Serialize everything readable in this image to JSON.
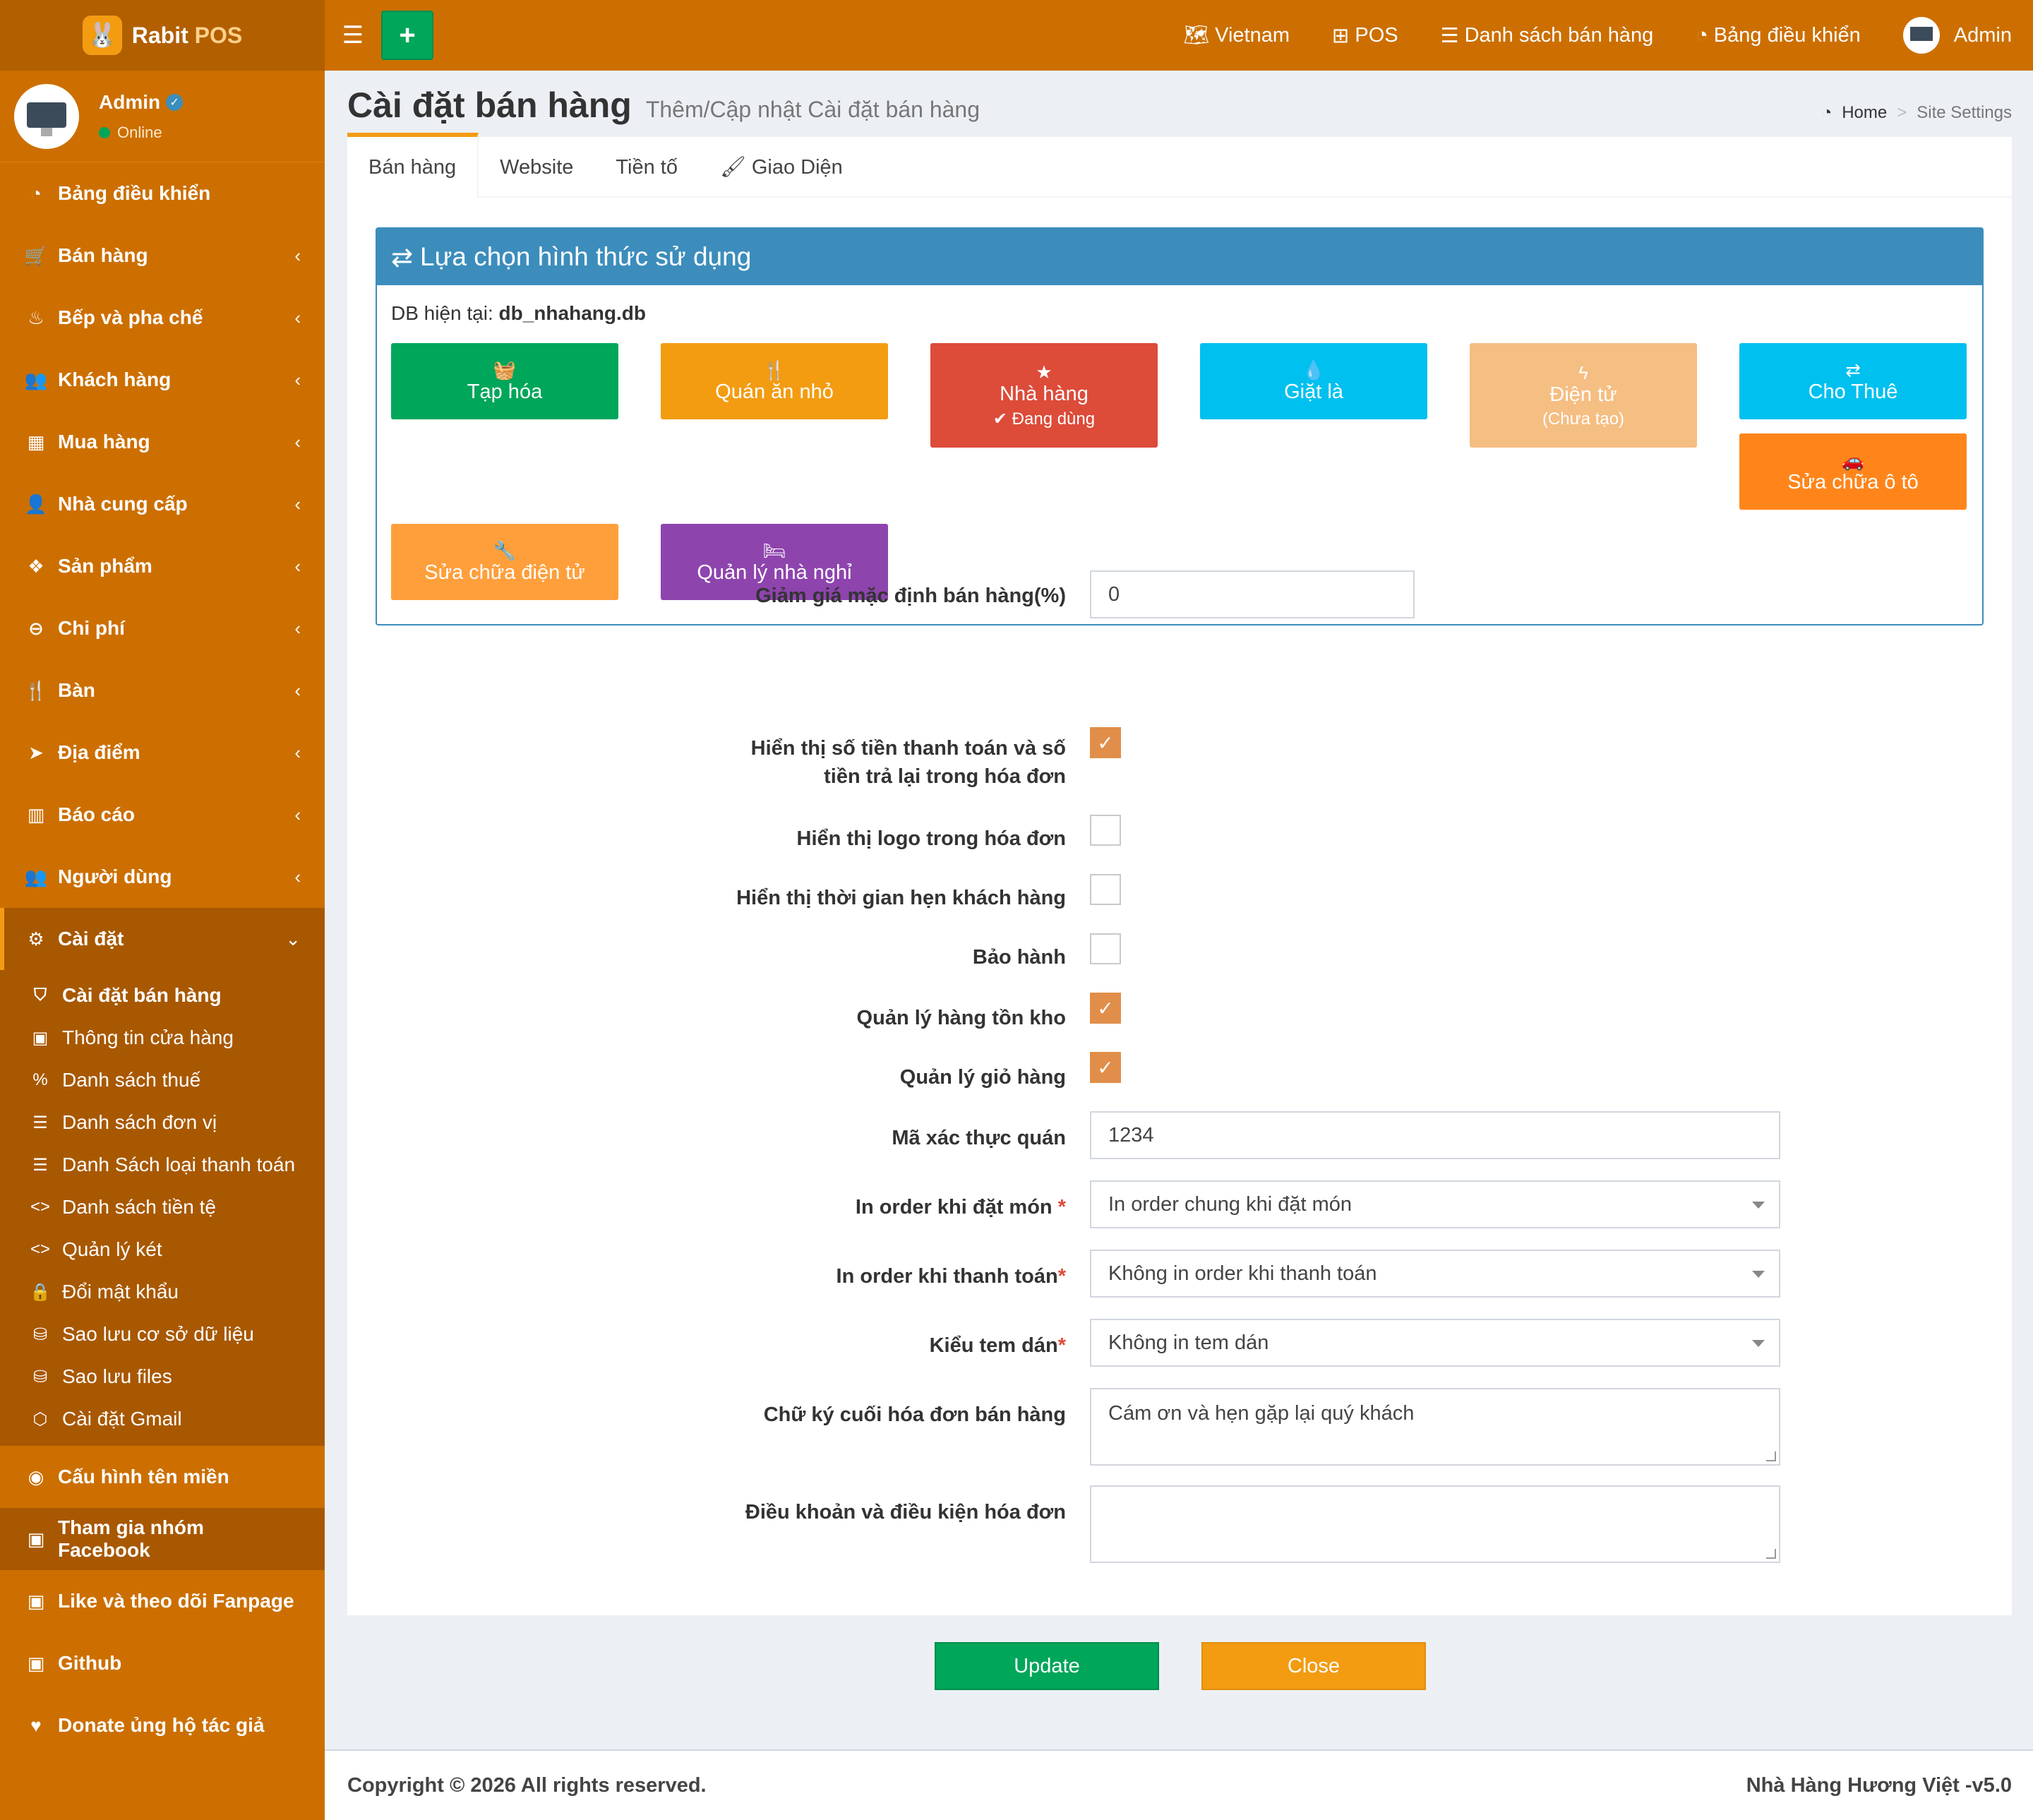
{
  "brand": {
    "name_part1": "Rabit",
    "name_part2": "POS"
  },
  "user": {
    "name": "Admin",
    "status": "Online"
  },
  "sidebar": {
    "items": [
      {
        "label": "Bảng điều khiển",
        "icon": "dashboard-icon",
        "glyph": "◔",
        "chevron": ""
      },
      {
        "label": "Bán hàng",
        "icon": "cart-icon",
        "glyph": "🛒",
        "chevron": "‹"
      },
      {
        "label": "Bếp và pha chế",
        "icon": "fire-icon",
        "glyph": "♨",
        "chevron": "‹"
      },
      {
        "label": "Khách hàng",
        "icon": "users-icon",
        "glyph": "👥",
        "chevron": "‹"
      },
      {
        "label": "Mua hàng",
        "icon": "grid-icon",
        "glyph": "▦",
        "chevron": "‹"
      },
      {
        "label": "Nhà cung cấp",
        "icon": "user-plus-icon",
        "glyph": "👤",
        "chevron": "‹"
      },
      {
        "label": "Sản phẩm",
        "icon": "cubes-icon",
        "glyph": "❖",
        "chevron": "‹"
      },
      {
        "label": "Chi phí",
        "icon": "minus-circle-icon",
        "glyph": "⊖",
        "chevron": "‹"
      },
      {
        "label": "Bàn",
        "icon": "cutlery-icon",
        "glyph": "🍴",
        "chevron": "‹"
      },
      {
        "label": "Địa điểm",
        "icon": "location-arrow-icon",
        "glyph": "➤",
        "chevron": "‹"
      },
      {
        "label": "Báo cáo",
        "icon": "bar-chart-icon",
        "glyph": "▥",
        "chevron": "‹"
      },
      {
        "label": "Người dùng",
        "icon": "users-icon",
        "glyph": "👥",
        "chevron": "‹"
      },
      {
        "label": "Cài đặt",
        "icon": "cogs-icon",
        "glyph": "⚙",
        "chevron": "⌄"
      }
    ],
    "submenu": [
      {
        "label": "Cài đặt bán hàng",
        "icon": "shield-icon",
        "glyph": "⛉"
      },
      {
        "label": "Thông tin cửa hàng",
        "icon": "briefcase-icon",
        "glyph": "▣"
      },
      {
        "label": "Danh sách thuế",
        "icon": "percent-icon",
        "glyph": "%"
      },
      {
        "label": "Danh sách đơn vị",
        "icon": "list-icon",
        "glyph": "☰"
      },
      {
        "label": "Danh Sách loại thanh toán",
        "icon": "list-icon",
        "glyph": "☰"
      },
      {
        "label": "Danh sách tiền tệ",
        "icon": "code-icon",
        "glyph": "<>"
      },
      {
        "label": "Quản lý két",
        "icon": "code-icon",
        "glyph": "<>"
      },
      {
        "label": "Đổi mật khẩu",
        "icon": "lock-icon",
        "glyph": "🔒"
      },
      {
        "label": "Sao lưu cơ sở dữ liệu",
        "icon": "database-icon",
        "glyph": "⛁"
      },
      {
        "label": "Sao lưu files",
        "icon": "database-icon",
        "glyph": "⛁"
      },
      {
        "label": "Cài đặt Gmail",
        "icon": "cube-icon",
        "glyph": "⬡"
      }
    ],
    "extra_items": [
      {
        "label": "Cấu hình tên miền",
        "icon": "globe-icon",
        "glyph": "◉"
      },
      {
        "label": "Tham gia nhóm Facebook",
        "icon": "briefcase-icon",
        "glyph": "▣"
      },
      {
        "label": "Like và theo dõi Fanpage",
        "icon": "briefcase-icon",
        "glyph": "▣"
      },
      {
        "label": "Github",
        "icon": "briefcase-icon",
        "glyph": "▣"
      },
      {
        "label": "Donate ủng hộ tác giả",
        "icon": "heart-icon",
        "glyph": "♥"
      }
    ]
  },
  "topnav": {
    "language": "Vietnam",
    "pos": "POS",
    "sales_list": "Danh sách bán hàng",
    "dashboard": "Bảng điều khiển",
    "user": "Admin"
  },
  "header": {
    "title": "Cài đặt bán hàng",
    "subtitle": "Thêm/Cập nhật Cài đặt bán hàng"
  },
  "breadcrumb": {
    "home": "Home",
    "current": "Site Settings",
    "sep": ">"
  },
  "tabs": [
    "Bán hàng",
    "Website",
    "Tiền tố",
    "Giao Diện"
  ],
  "panel": {
    "title": "Lựa chọn hình thức sử dụng",
    "db_label": "DB hiện tại:",
    "db_name": "db_nhahang.db",
    "modes": [
      {
        "label": "Tạp hóa",
        "sub": "",
        "icon": "basket-icon",
        "glyph": "🧺",
        "color": "#00a65a"
      },
      {
        "label": "Quán ăn nhỏ",
        "sub": "",
        "icon": "cutlery-icon",
        "glyph": "🍴",
        "color": "#f39c12"
      },
      {
        "label": "Nhà hàng",
        "sub": "✔ Đang dùng",
        "icon": "star-icon",
        "glyph": "★",
        "color": "#dd4b39"
      },
      {
        "label": "Giặt là",
        "sub": "",
        "icon": "tint-icon",
        "glyph": "💧",
        "color": "#00c0ef"
      },
      {
        "label": "Điện tử",
        "sub": "(Chưa tạo)",
        "icon": "bolt-icon",
        "glyph": "ϟ",
        "color": "#f5be82"
      },
      {
        "label": "Cho Thuê",
        "sub": "",
        "icon": "exchange-icon",
        "glyph": "⇄",
        "color": "#00c0ef"
      },
      {
        "label": "Sửa chữa ô tô",
        "sub": "",
        "icon": "car-icon",
        "glyph": "🚗",
        "color": "#ff851b"
      },
      {
        "label": "Sửa chữa điện tử",
        "sub": "",
        "icon": "wrench-icon",
        "glyph": "🔧",
        "color": "#ff9f3b"
      },
      {
        "label": "Quản lý nhà nghỉ",
        "sub": "",
        "icon": "bed-icon",
        "glyph": "🛏",
        "color": "#8e44ad"
      }
    ]
  },
  "form": {
    "discount_label": "Giảm giá mặc định bán hàng(%)",
    "discount_value": "0",
    "show_payment_label_1": "Hiển thị số tiền thanh toán và số",
    "show_payment_label_2": "tiền trả lại trong hóa đơn",
    "show_payment_checked": true,
    "show_logo_label": "Hiển thị logo trong hóa đơn",
    "show_logo_checked": false,
    "show_time_label": "Hiển thị thời gian hẹn khách hàng",
    "show_time_checked": false,
    "warranty_label": "Bảo hành",
    "warranty_checked": false,
    "inventory_label": "Quản lý hàng tồn kho",
    "inventory_checked": true,
    "cart_label": "Quản lý giỏ hàng",
    "cart_checked": true,
    "auth_code_label": "Mã xác thực quán",
    "auth_code_value": "1234",
    "print_order_label": "In order khi đặt món",
    "print_order_value": "In order chung khi đặt món",
    "print_payment_label": "In order khi thanh toán",
    "print_payment_value": "Không in order khi thanh toán",
    "sticker_label": "Kiểu tem dán",
    "sticker_value": "Không in tem dán",
    "signature_label": "Chữ ký cuối hóa đơn bán hàng",
    "signature_value": "Cám ơn và hẹn gặp lại quý khách",
    "terms_label": "Điều khoản và điều kiện hóa đơn",
    "terms_value": "",
    "required_mark": "*"
  },
  "buttons": {
    "update": "Update",
    "close": "Close"
  },
  "footer": {
    "copyright": "Copyright © 2026 All rights reserved.",
    "version": "Nhà Hàng Hương Việt -v5.0"
  },
  "colors": {
    "primary_orange": "#cc6f00",
    "panel_blue": "#3c8dbc",
    "success": "#00a65a",
    "warning": "#f39c12"
  }
}
